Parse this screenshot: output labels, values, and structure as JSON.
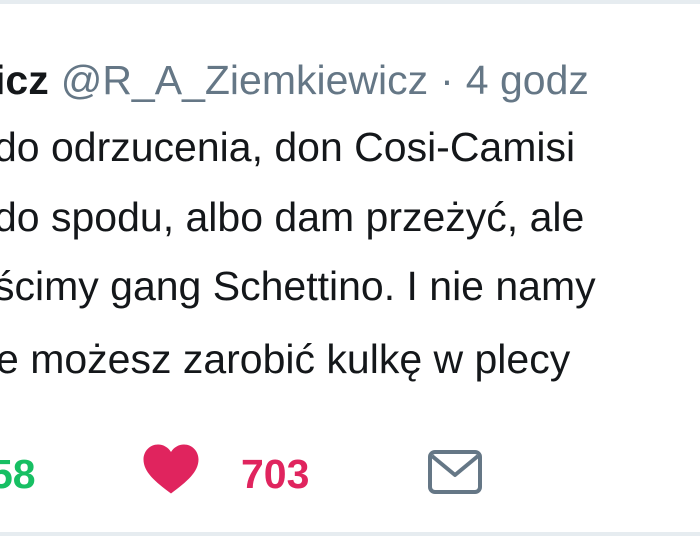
{
  "tweet": {
    "author_name_visible": "icz",
    "handle": "@R_A_Ziemkiewicz",
    "separator": "·",
    "time": "4 godz",
    "lines": [
      "do odrzucenia, don Cosi-Camisi",
      "do spodu, albo dam przeżyć, ale",
      "ścimy gang Schettino. I nie namy",
      "e możesz zarobić kulkę w plecy"
    ]
  },
  "actions": {
    "retweet_count": "58",
    "like_count": "703",
    "like_icon": "heart-icon",
    "message_icon": "envelope-icon"
  },
  "colors": {
    "text": "#14171a",
    "muted": "#657786",
    "retweet": "#17bf63",
    "like": "#e0245e",
    "border": "#e6ecf0"
  }
}
